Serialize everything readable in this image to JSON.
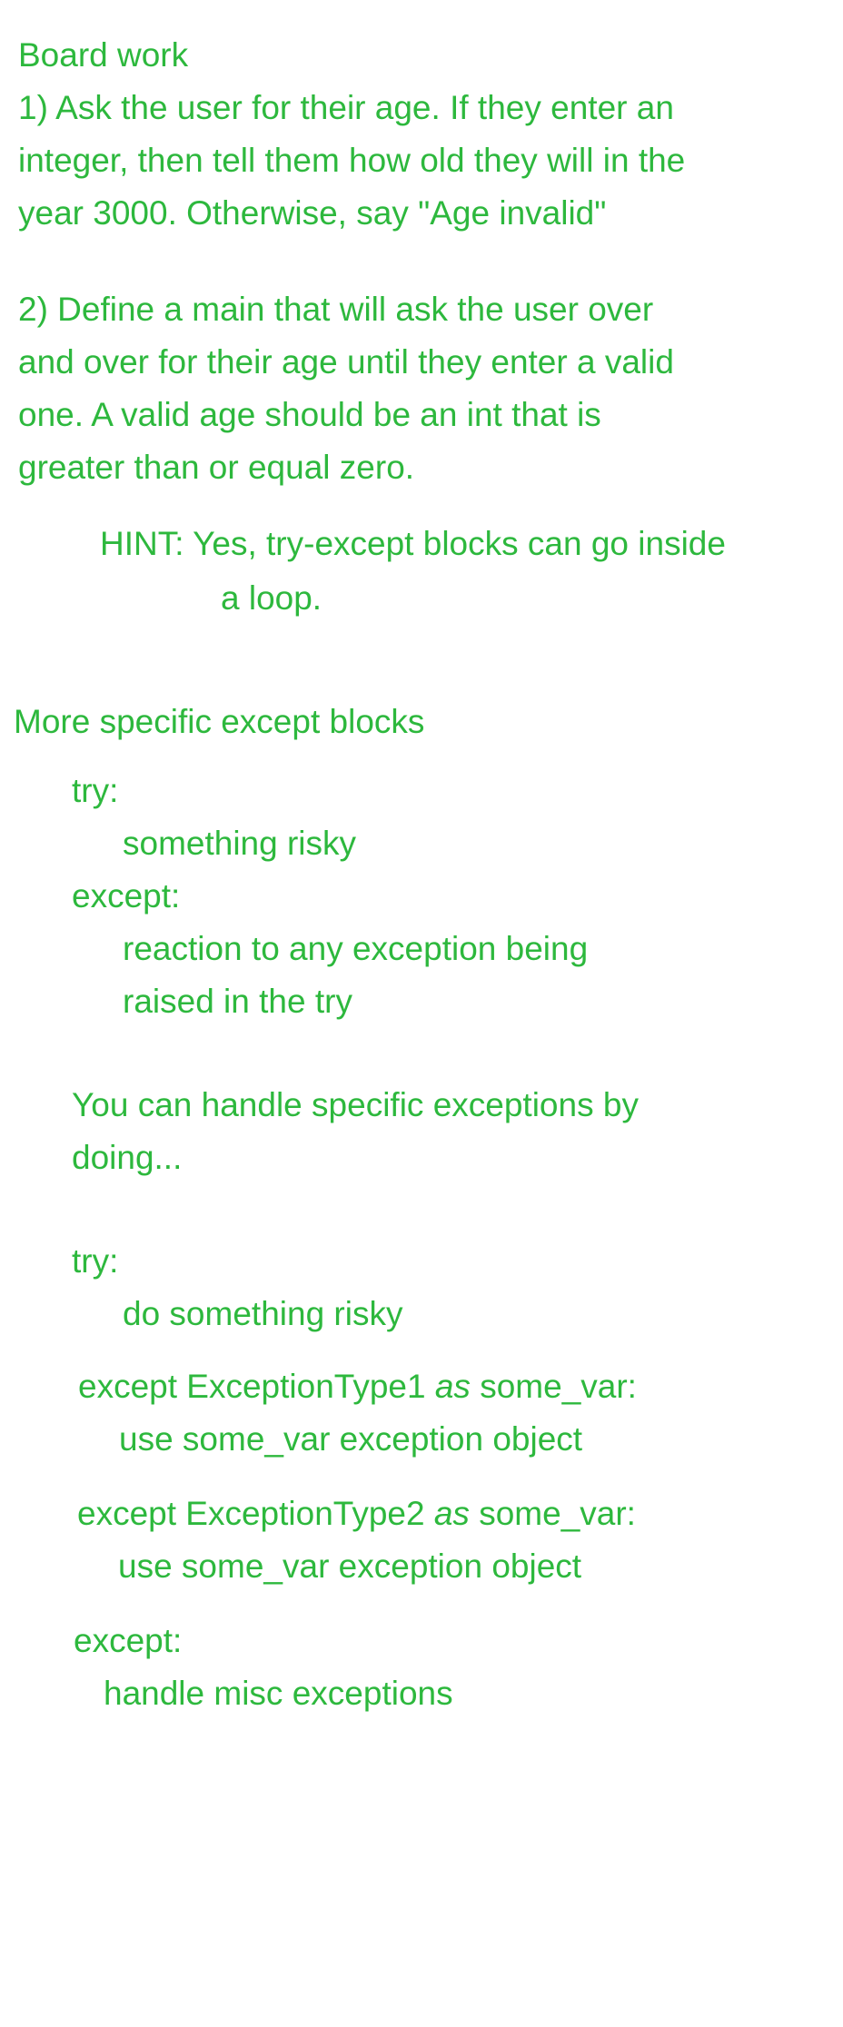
{
  "colors": {
    "text": "#2db83d",
    "background": "#ffffff"
  },
  "board_work": {
    "title": "Board work",
    "q1_line1": "1) Ask the user for their age. If they enter an",
    "q1_line2": "integer, then tell them how old they will in the",
    "q1_line3": "year 3000. Otherwise, say \"Age invalid\"",
    "q2_line1": "2) Define a main that will ask the user over",
    "q2_line2": "and over for their age until they enter a valid",
    "q2_line3": "one. A valid age should be an int that is",
    "q2_line4": "greater than or equal zero.",
    "hint_line1": "HINT: Yes, try-except blocks can go inside",
    "hint_line2": "a loop."
  },
  "specific_except": {
    "title": "More specific except blocks",
    "block1": {
      "try": "try:",
      "try_body": "something risky",
      "except": "except:",
      "except_body1": "reaction to any exception being",
      "except_body2": "raised in the try"
    },
    "explain_line1": "You can handle specific exceptions by",
    "explain_line2": "doing...",
    "block2": {
      "try": "try:",
      "try_body": "do something risky",
      "except1_prefix": "except ExceptionType1 ",
      "except1_as": "as",
      "except1_suffix": " some_var:",
      "except1_body": "use some_var exception object",
      "except2_prefix": "except ExceptionType2 ",
      "except2_as": "as",
      "except2_suffix": " some_var:",
      "except2_body": "use some_var exception object",
      "except3": "except:",
      "except3_body": "handle misc exceptions"
    }
  }
}
